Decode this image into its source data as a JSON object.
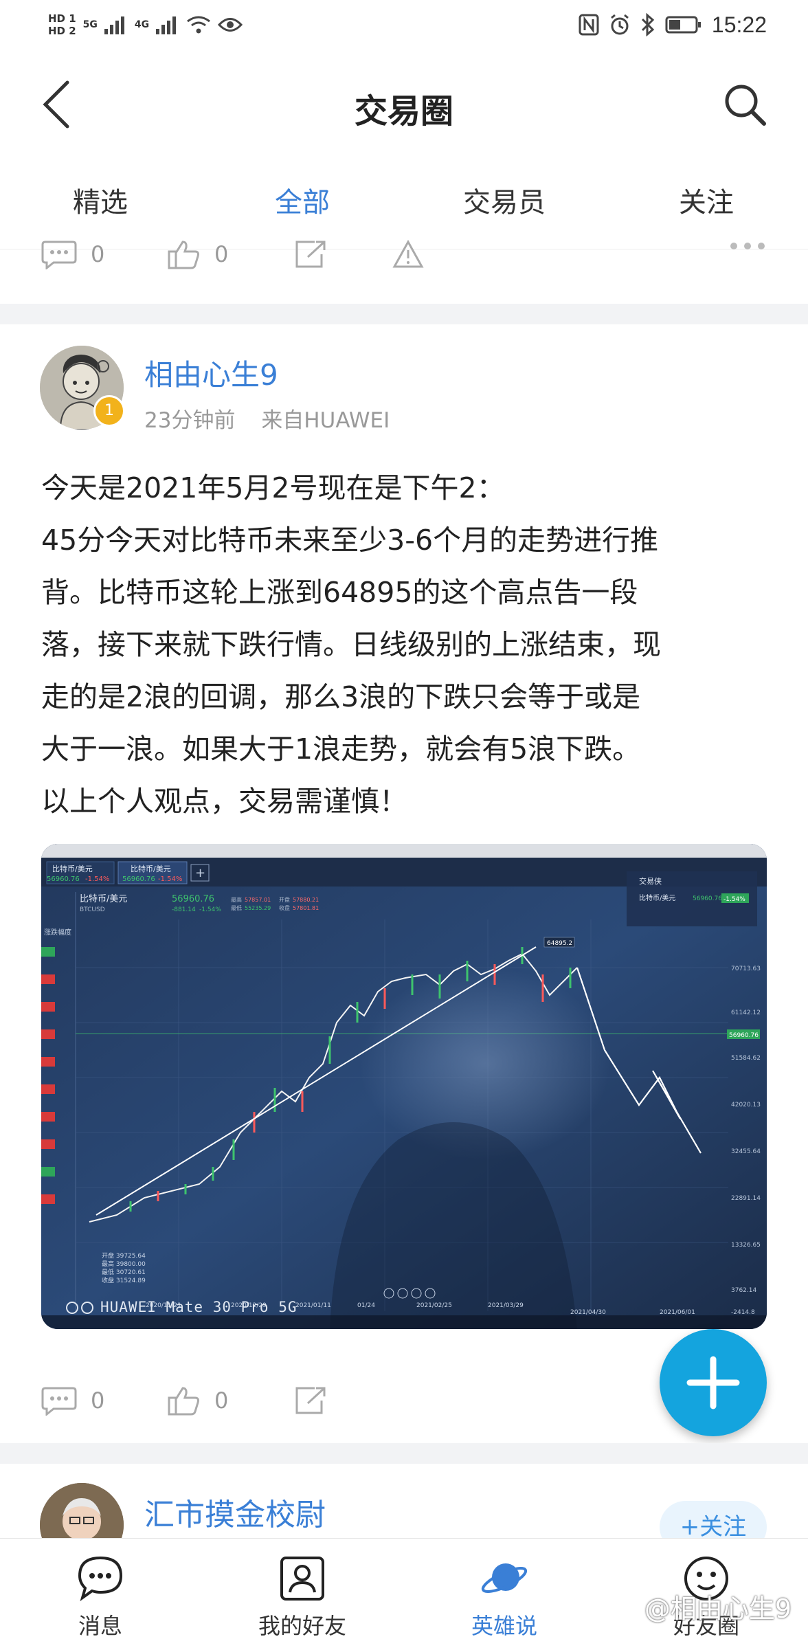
{
  "status_bar": {
    "hd1": "HD 1",
    "hd2": "HD 2",
    "net1": "5G",
    "net2": "4G",
    "time": "15:22",
    "icons": [
      "nfc-icon",
      "alarm-icon",
      "bluetooth-icon",
      "battery-icon",
      "wifi-icon",
      "eye-icon"
    ]
  },
  "header": {
    "title": "交易圈",
    "back_icon": "chevron-left-icon",
    "search_icon": "search-icon"
  },
  "tabs": [
    {
      "label": "精选",
      "active": false
    },
    {
      "label": "全部",
      "active": true
    },
    {
      "label": "交易员",
      "active": false
    },
    {
      "label": "关注",
      "active": false
    }
  ],
  "prev_post_actions": {
    "comments": "0",
    "likes": "0"
  },
  "post": {
    "author": "相由心生9",
    "level": "1",
    "time_ago": "23分钟前",
    "source": "来自HUAWEI",
    "lines": [
      "今天是2021年5月2号现在是下午2：",
      "45分今天对比特币未来至少3-6个月的走势进行推",
      "背。比特币这轮上涨到64895的这个高点告一段",
      "落，接下来就下跌行情。日线级别的上涨结束，现",
      "走的是2浪的回调，那么3浪的下跌只会等于或是",
      "大于一浪。如果大于1浪走势，就会有5浪下跌。",
      "以上个人观点，交易需谨慎！"
    ],
    "photo": {
      "watermark": "HUAWEI Mate 30 Pro 5G",
      "tab1": "比特币/美元",
      "tab1_price": "56960.76",
      "tab1_change": "-1.54%",
      "tab2": "比特币/美元",
      "tab2_price": "56960.76",
      "tab2_change": "-1.54%",
      "symbol": "比特币/美元",
      "symbol_code": "BTCUSD",
      "price": "56960.76",
      "change_abs": "-881.14",
      "change_pct": "-1.54%",
      "high_label": "最高",
      "high_value": "57857.01",
      "low_label": "最低",
      "low_value": "55235.29",
      "open_label": "开盘",
      "open_value": "57880.21",
      "close_label": "收盘",
      "close_value": "57801.81",
      "peak_label": "64895.2",
      "right_panel_title": "交易侠",
      "right_panel_symbol": "比特币/美元",
      "right_panel_price": "56960.76",
      "right_panel_change": "-1.54%",
      "left_label": "涨跌幅度",
      "ohlc_block": [
        "开盘 39725.64",
        "最高 39800.00",
        "最低 30720.61",
        "收盘 31524.89"
      ],
      "y_ticks": [
        "70713.63",
        "61142.12",
        "51584.62",
        "42020.13",
        "32455.64",
        "22891.14",
        "13326.65",
        "3762.14",
        "-2414.8"
      ],
      "last_price_tag": "56960.76",
      "x_ticks": [
        "2020/11/21",
        "2020/12/29",
        "2021/01/11",
        "01/24",
        "2021/02/25",
        "2021/03/29",
        "2021/04/30",
        "2021/06/01"
      ],
      "chart_note": "hand-photographed BTC/USD daily candlestick chart with drawn wave projection"
    },
    "actions": {
      "comments": "0",
      "likes": "0"
    },
    "fab_icon": "plus-icon"
  },
  "next_post": {
    "author": "汇市摸金校尉",
    "follow_label": "+关注"
  },
  "bottom_nav": [
    {
      "label": "消息",
      "icon": "chat-bubble-icon",
      "active": false
    },
    {
      "label": "我的好友",
      "icon": "contact-card-icon",
      "active": false
    },
    {
      "label": "英雄说",
      "icon": "planet-icon",
      "active": true
    },
    {
      "label": "好友圈",
      "icon": "smiley-icon",
      "active": false
    }
  ],
  "brand_watermark": "@相由心生9",
  "colors": {
    "accent": "#3a7fd6",
    "fab": "#14a4de",
    "divider": "#f2f3f5"
  }
}
